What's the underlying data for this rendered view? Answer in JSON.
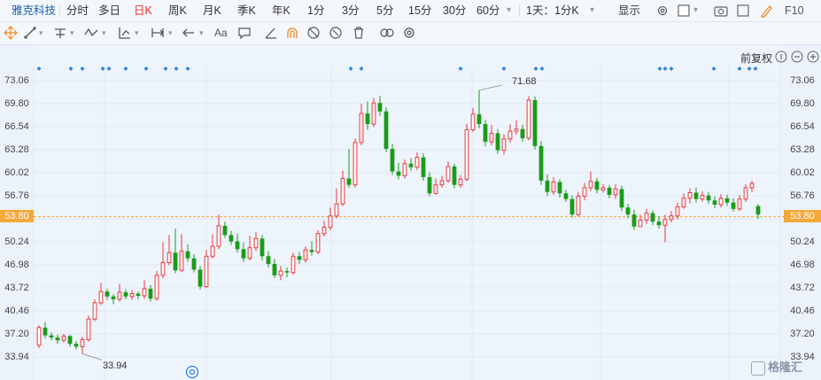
{
  "toolbar": {
    "stock_name": "雅克科技",
    "items": [
      "分时",
      "多日",
      "日K",
      "周K",
      "月K",
      "季K",
      "年K",
      "1分",
      "3分",
      "5分",
      "15分",
      "30分",
      "60分"
    ],
    "active_index": 2,
    "period_select": "1天：1分K",
    "display_label": "显示",
    "f10_label": "F10"
  },
  "drawbar": {
    "text_tool_label": "Aa"
  },
  "adjust_label": "前复权",
  "price_axis": {
    "ticks": [
      "73.06",
      "69.80",
      "66.54",
      "63.28",
      "60.02",
      "56.76",
      "53.80",
      "50.24",
      "46.98",
      "43.72",
      "40.46",
      "37.20",
      "33.94"
    ],
    "current": "53.80"
  },
  "annotations": {
    "high_label": "71.68",
    "low_label": "33.94"
  },
  "watermark": "格隆汇",
  "colors": {
    "up": "#e8383d",
    "down": "#1a9b1a",
    "event_marker": "#2e86de",
    "current_line": "#f3a93b",
    "name": "#1a5fb4"
  },
  "chart_data": {
    "type": "candlestick",
    "y_range": [
      33.94,
      73.06
    ],
    "current_price": 53.8,
    "high": 71.68,
    "low": 33.94,
    "candles": [
      [
        35.6,
        38.1,
        38.4,
        35.2
      ],
      [
        38.1,
        37.0,
        38.9,
        36.6
      ],
      [
        37.0,
        36.7,
        37.4,
        36.3
      ],
      [
        36.7,
        36.3,
        37.1,
        35.8
      ],
      [
        36.3,
        36.9,
        37.2,
        36.0
      ],
      [
        36.9,
        35.8,
        37.1,
        35.4
      ],
      [
        35.8,
        35.4,
        36.2,
        35.0
      ],
      [
        35.4,
        36.4,
        36.8,
        34.4
      ],
      [
        36.4,
        39.3,
        39.8,
        36.1
      ],
      [
        39.3,
        41.6,
        42.1,
        39.0
      ],
      [
        41.6,
        43.2,
        44.4,
        41.3
      ],
      [
        43.2,
        42.5,
        43.6,
        42.0
      ],
      [
        42.5,
        42.1,
        42.8,
        41.4
      ],
      [
        42.1,
        43.1,
        44.3,
        41.8
      ],
      [
        43.1,
        42.5,
        43.5,
        42.1
      ],
      [
        42.5,
        42.9,
        43.4,
        42.0
      ],
      [
        42.9,
        42.6,
        43.2,
        42.1
      ],
      [
        42.6,
        43.6,
        44.8,
        42.2
      ],
      [
        43.6,
        42.2,
        44.1,
        41.8
      ],
      [
        42.2,
        45.5,
        46.1,
        41.9
      ],
      [
        45.5,
        47.3,
        50.2,
        45.1
      ],
      [
        47.3,
        48.7,
        51.2,
        46.9
      ],
      [
        48.7,
        46.2,
        52.1,
        45.8
      ],
      [
        46.2,
        48.9,
        51.3,
        46.0
      ],
      [
        48.9,
        47.9,
        49.9,
        47.4
      ],
      [
        47.9,
        46.3,
        48.5,
        45.9
      ],
      [
        46.3,
        43.9,
        46.8,
        43.5
      ],
      [
        43.9,
        48.2,
        49.1,
        43.7
      ],
      [
        48.2,
        49.6,
        51.3,
        47.9
      ],
      [
        49.6,
        52.5,
        54.1,
        49.2
      ],
      [
        52.5,
        51.2,
        53.1,
        50.8
      ],
      [
        51.2,
        50.3,
        51.8,
        49.8
      ],
      [
        50.3,
        49.2,
        51.4,
        48.7
      ],
      [
        49.2,
        47.9,
        50.1,
        47.4
      ],
      [
        47.9,
        49.4,
        51.1,
        47.6
      ],
      [
        49.4,
        50.7,
        51.6,
        48.9
      ],
      [
        50.7,
        48.2,
        51.2,
        47.6
      ],
      [
        48.2,
        47.1,
        48.9,
        46.6
      ],
      [
        47.1,
        45.5,
        47.8,
        45.1
      ],
      [
        45.5,
        46.1,
        46.8,
        44.8
      ],
      [
        46.1,
        45.9,
        46.6,
        45.2
      ],
      [
        45.9,
        48.2,
        48.7,
        45.6
      ],
      [
        48.2,
        47.7,
        48.8,
        47.1
      ],
      [
        47.7,
        49.1,
        49.6,
        47.3
      ],
      [
        49.1,
        48.8,
        50.3,
        48.3
      ],
      [
        48.8,
        51.4,
        51.9,
        48.5
      ],
      [
        51.4,
        52.3,
        53.2,
        51.0
      ],
      [
        52.3,
        53.9,
        55.1,
        51.9
      ],
      [
        53.9,
        55.6,
        57.8,
        53.6
      ],
      [
        55.6,
        59.2,
        60.3,
        55.3
      ],
      [
        59.2,
        58.3,
        63.4,
        57.9
      ],
      [
        58.3,
        64.3,
        64.9,
        57.9
      ],
      [
        64.3,
        68.4,
        69.8,
        63.9
      ],
      [
        68.4,
        66.9,
        70.1,
        66.1
      ],
      [
        66.9,
        69.9,
        70.6,
        66.5
      ],
      [
        69.9,
        68.7,
        70.9,
        68.1
      ],
      [
        68.7,
        63.4,
        69.3,
        62.9
      ],
      [
        63.4,
        60.2,
        64.1,
        59.7
      ],
      [
        60.2,
        59.6,
        61.4,
        59.1
      ],
      [
        59.6,
        61.3,
        61.9,
        59.2
      ],
      [
        61.3,
        60.8,
        62.1,
        60.3
      ],
      [
        60.8,
        62.2,
        62.9,
        60.4
      ],
      [
        62.2,
        59.4,
        62.8,
        58.9
      ],
      [
        59.4,
        57.1,
        60.1,
        56.7
      ],
      [
        57.1,
        58.3,
        59.2,
        56.9
      ],
      [
        58.3,
        58.9,
        59.6,
        57.9
      ],
      [
        58.9,
        60.9,
        61.6,
        58.6
      ],
      [
        60.9,
        58.3,
        61.3,
        57.8
      ],
      [
        58.3,
        59.1,
        59.7,
        57.9
      ],
      [
        59.1,
        66.1,
        66.9,
        58.8
      ],
      [
        66.1,
        68.3,
        69.2,
        65.8
      ],
      [
        68.3,
        66.9,
        71.68,
        66.3
      ],
      [
        66.9,
        64.4,
        67.5,
        63.8
      ],
      [
        64.4,
        65.6,
        66.8,
        63.9
      ],
      [
        65.6,
        63.2,
        66.2,
        62.7
      ],
      [
        63.2,
        64.8,
        65.5,
        62.6
      ],
      [
        64.8,
        65.9,
        66.9,
        64.3
      ],
      [
        65.9,
        66.2,
        67.4,
        65.4
      ],
      [
        66.2,
        64.9,
        66.8,
        64.4
      ],
      [
        64.9,
        70.3,
        70.9,
        64.6
      ],
      [
        70.3,
        63.8,
        70.8,
        63.3
      ],
      [
        63.8,
        58.9,
        64.5,
        58.3
      ],
      [
        58.9,
        57.3,
        59.8,
        56.7
      ],
      [
        57.3,
        58.7,
        59.4,
        56.9
      ],
      [
        58.7,
        57.1,
        59.1,
        56.5
      ],
      [
        57.1,
        56.3,
        57.6,
        55.9
      ],
      [
        56.3,
        54.1,
        56.8,
        53.7
      ],
      [
        54.1,
        56.7,
        57.3,
        53.8
      ],
      [
        56.7,
        57.9,
        58.6,
        56.1
      ],
      [
        57.9,
        58.8,
        60.2,
        57.4
      ],
      [
        58.8,
        57.6,
        59.3,
        57.1
      ],
      [
        57.6,
        57.9,
        58.4,
        57.2
      ],
      [
        57.9,
        56.9,
        58.3,
        56.4
      ],
      [
        56.9,
        57.7,
        58.4,
        56.3
      ],
      [
        57.7,
        55.1,
        58.2,
        54.6
      ],
      [
        55.1,
        54.1,
        55.6,
        53.6
      ],
      [
        54.1,
        52.4,
        54.8,
        51.9
      ],
      [
        52.4,
        53.3,
        54.1,
        52.6
      ],
      [
        53.3,
        54.3,
        54.9,
        52.8
      ],
      [
        54.3,
        53.1,
        54.7,
        52.6
      ],
      [
        53.1,
        52.6,
        53.9,
        52.1
      ],
      [
        52.6,
        53.4,
        54.1,
        50.2
      ],
      [
        53.4,
        53.9,
        54.6,
        53.0
      ],
      [
        53.9,
        55.2,
        55.8,
        53.4
      ],
      [
        55.2,
        56.4,
        57.1,
        54.9
      ],
      [
        56.4,
        57.2,
        57.8,
        55.7
      ],
      [
        57.2,
        56.3,
        57.9,
        55.8
      ],
      [
        56.3,
        56.8,
        57.4,
        55.9
      ],
      [
        56.8,
        56.1,
        57.3,
        55.6
      ],
      [
        56.1,
        55.5,
        56.7,
        55.0
      ],
      [
        55.5,
        56.4,
        57.0,
        55.1
      ],
      [
        56.4,
        55.8,
        56.9,
        55.3
      ],
      [
        55.8,
        54.9,
        56.4,
        54.5
      ],
      [
        54.9,
        56.3,
        56.9,
        54.6
      ],
      [
        56.3,
        57.9,
        58.4,
        55.9
      ],
      [
        57.9,
        58.5,
        58.9,
        57.3
      ],
      [
        55.3,
        54.1,
        55.6,
        53.5
      ]
    ]
  }
}
